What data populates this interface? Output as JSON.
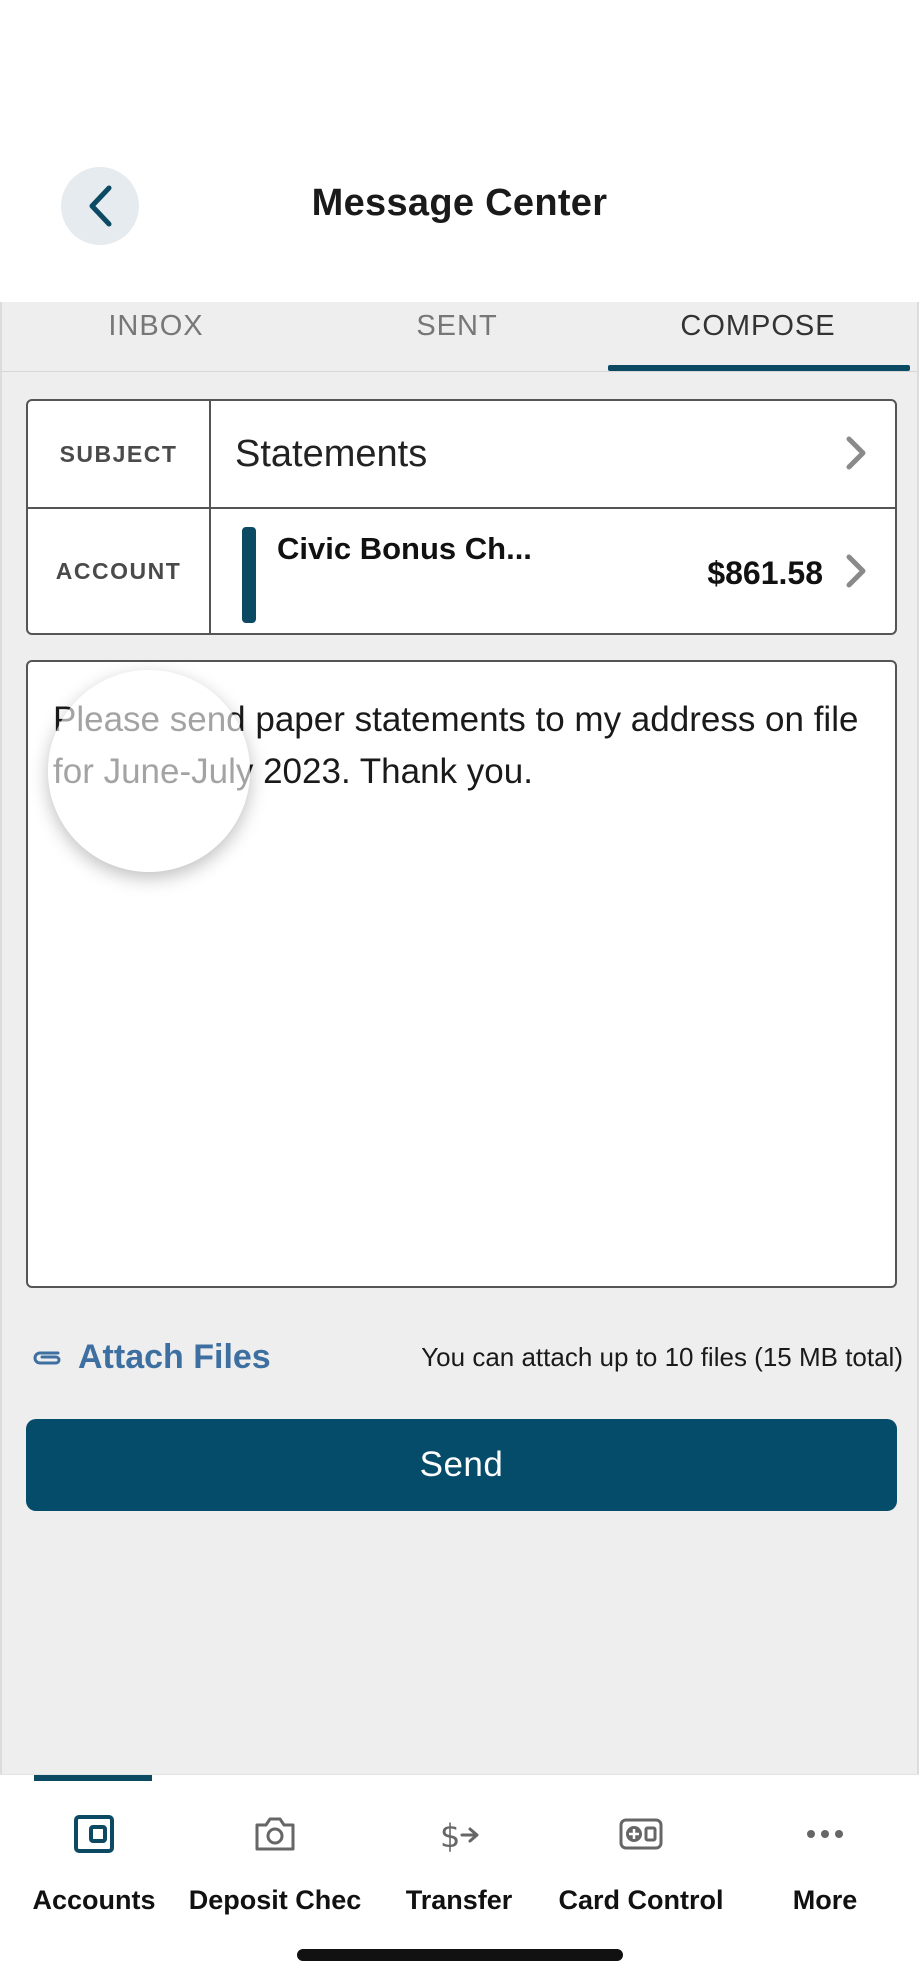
{
  "header": {
    "title": "Message Center",
    "back_icon": "chevron-left-icon"
  },
  "tabs": [
    {
      "label": "INBOX",
      "active": false
    },
    {
      "label": "SENT",
      "active": false
    },
    {
      "label": "COMPOSE",
      "active": true
    }
  ],
  "form": {
    "subject_label": "SUBJECT",
    "subject_value": "Statements",
    "account_label": "ACCOUNT",
    "account_name": "Civic Bonus Ch...",
    "account_balance": "$861.58",
    "message": "Please send paper statements to my address on file for June-July 2023. Thank you."
  },
  "attach": {
    "label": "Attach Files",
    "note": "You can attach up to 10 files (15 MB total)",
    "icon": "paperclip-icon"
  },
  "send_label": "Send",
  "nav": [
    {
      "label": "Accounts",
      "icon": "wallet-icon",
      "active": true
    },
    {
      "label": "Deposit Chec",
      "icon": "camera-icon",
      "active": false
    },
    {
      "label": "Transfer",
      "icon": "transfer-dollar-icon",
      "active": false
    },
    {
      "label": "Card Control",
      "icon": "card-control-icon",
      "active": false
    },
    {
      "label": "More",
      "icon": "more-dots-icon",
      "active": false
    }
  ],
  "colors": {
    "primary": "#054c6b",
    "link": "#3d6fa0",
    "background": "#eeeeef"
  }
}
